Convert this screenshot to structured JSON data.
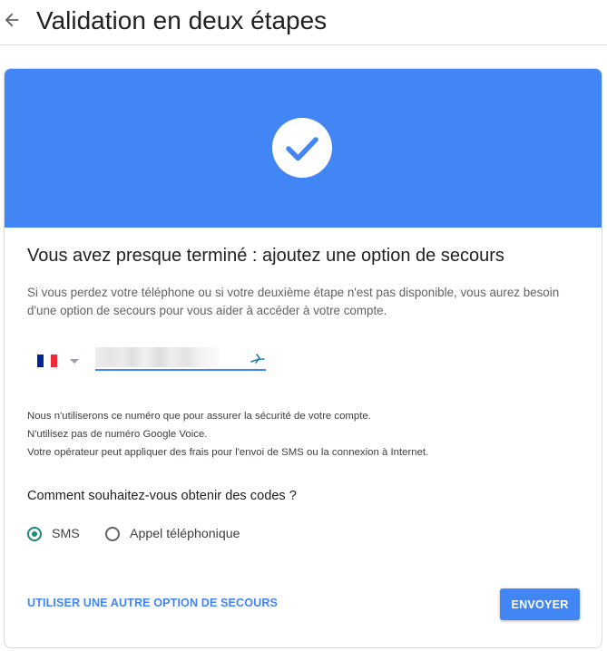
{
  "header": {
    "title": "Validation en deux étapes",
    "back_icon": "arrow-left-icon"
  },
  "hero": {
    "icon": "check-circle-icon",
    "color": "#4285f4"
  },
  "content": {
    "headline": "Vous avez presque terminé : ajoutez une option de secours",
    "description": "Si vous perdez votre téléphone ou si votre deuxième étape n'est pas disponible, vous aurez besoin d'une option de secours pour vous aider à accéder à votre compte.",
    "phone": {
      "country_flag": "france-flag-icon",
      "dropdown_icon": "caret-down-icon",
      "value": "",
      "status_icon": "phone-input-icon"
    },
    "notes": [
      "Nous n'utiliserons ce numéro que pour assurer la sécurité de votre compte.",
      "N'utilisez pas de numéro Google Voice.",
      "Votre opérateur peut appliquer des frais pour l'envoi de SMS ou la connexion à Internet."
    ],
    "question": "Comment souhaitez-vous obtenir des codes ?",
    "options": [
      {
        "label": "SMS",
        "selected": true
      },
      {
        "label": "Appel téléphonique",
        "selected": false
      }
    ]
  },
  "actions": {
    "alt_link": "UTILISER UNE AUTRE OPTION DE SECOURS",
    "send": "ENVOYER"
  },
  "colors": {
    "accent": "#4285f4",
    "radio_selected": "#1a8a7a"
  }
}
